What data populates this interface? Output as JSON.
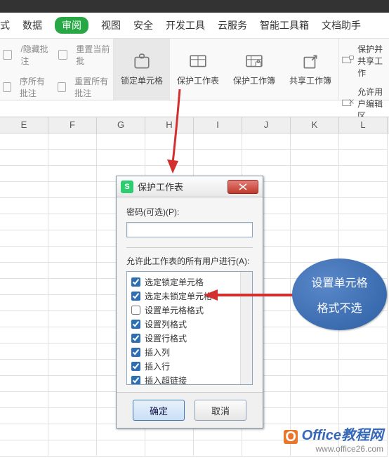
{
  "menu": {
    "items": [
      "式",
      "数据",
      "审阅",
      "视图",
      "安全",
      "开发工具",
      "云服务",
      "智能工具箱",
      "文档助手"
    ],
    "active_index": 2
  },
  "ribbon_left": {
    "row1": [
      "/隐藏批注",
      "重置当前批"
    ],
    "row2": [
      "序所有批注",
      "重置所有批注"
    ]
  },
  "ribbon_groups": [
    {
      "label": "锁定单元格",
      "selected": true
    },
    {
      "label": "保护工作表"
    },
    {
      "label": "保护工作簿"
    },
    {
      "label": "共享工作簿"
    }
  ],
  "ribbon_right": {
    "row1": "保护并共享工作",
    "row2": "允许用户编辑区"
  },
  "columns": [
    "E",
    "F",
    "G",
    "H",
    "I",
    "J",
    "K",
    "L"
  ],
  "dialog": {
    "title": "保护工作表",
    "password_label": "密码(可选)(P):",
    "password_value": "",
    "perm_label": "允许此工作表的所有用户进行(A):",
    "perms": [
      {
        "label": "选定锁定单元格",
        "checked": true
      },
      {
        "label": "选定未锁定单元格",
        "checked": true
      },
      {
        "label": "设置单元格格式",
        "checked": false
      },
      {
        "label": "设置列格式",
        "checked": true
      },
      {
        "label": "设置行格式",
        "checked": true
      },
      {
        "label": "插入列",
        "checked": true
      },
      {
        "label": "插入行",
        "checked": true
      },
      {
        "label": "插入超链接",
        "checked": true
      }
    ],
    "ok": "确定",
    "cancel": "取消"
  },
  "callout": {
    "line1": "设置单元格",
    "line2": "格式不选"
  },
  "watermark": {
    "brand": "Office教程网",
    "url": "www.office26.com"
  }
}
